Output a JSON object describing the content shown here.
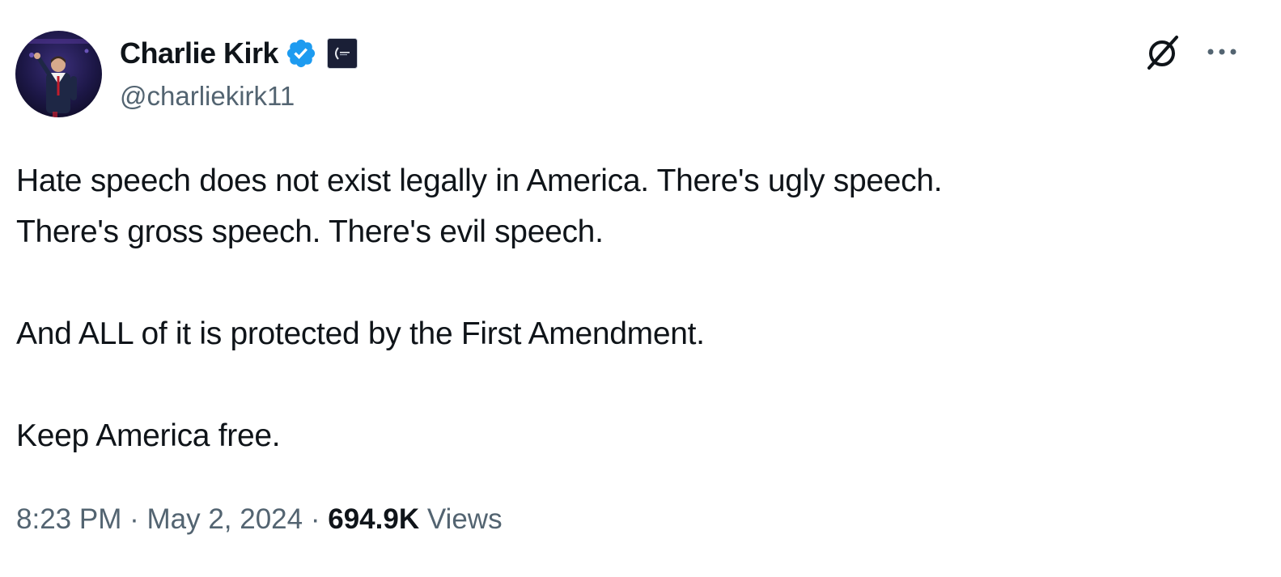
{
  "author": {
    "display_name": "Charlie Kirk",
    "handle": "@charliekirk11",
    "verified": true,
    "badge_icon": "verified-badge-icon",
    "affiliate_icon": "organization-affiliate-icon"
  },
  "header_actions": {
    "grok_icon": "grok-icon",
    "more_icon": "more-options-icon"
  },
  "tweet": {
    "line1": "Hate speech does not exist legally in America. There's ugly speech.",
    "line2": "There's gross speech. There's evil speech.",
    "line3": "And ALL of it is protected by the First Amendment.",
    "line4": "Keep America free."
  },
  "meta": {
    "time": "8:23 PM",
    "separator": "·",
    "date": "May 2, 2024",
    "views_count": "694.9K",
    "views_label": "Views"
  },
  "colors": {
    "text_primary": "#0f1419",
    "text_secondary": "#536471",
    "verified_blue": "#1d9bf0",
    "background": "#ffffff"
  }
}
